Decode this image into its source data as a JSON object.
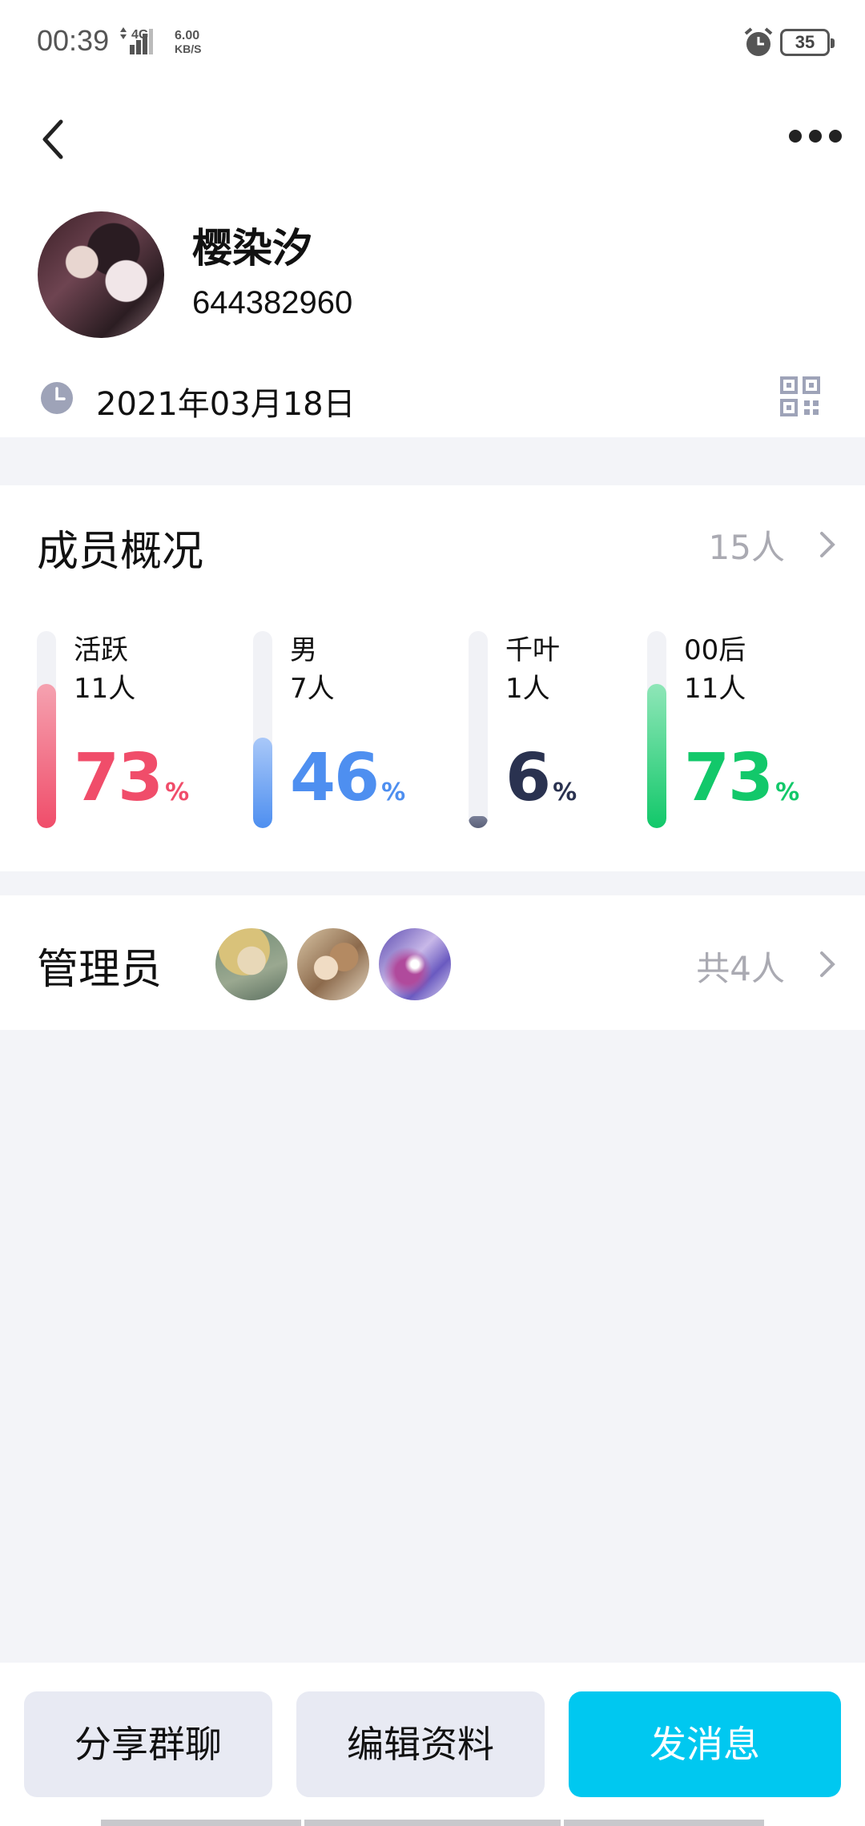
{
  "status_bar": {
    "time": "00:39",
    "network": "4G",
    "speed_value": "6.00",
    "speed_unit": "KB/S",
    "battery": "35"
  },
  "profile": {
    "name": "樱染汐",
    "id": "644382960",
    "date": "2021年03月18日"
  },
  "members": {
    "title": "成员概况",
    "total": "15人",
    "stats": [
      {
        "label": "活跃",
        "count": "11人",
        "percent": "73",
        "fraction": 0.73,
        "color": "#f04d6a",
        "fill_top": "#f5a2b0",
        "fill_bottom": "#f04d6a"
      },
      {
        "label": "男",
        "count": "7人",
        "percent": "46",
        "fraction": 0.46,
        "color": "#4e8ff0",
        "fill_top": "#a9c8f8",
        "fill_bottom": "#4e8ff0"
      },
      {
        "label": "千叶",
        "count": "1人",
        "percent": "6",
        "fraction": 0.06,
        "color": "#2a3250",
        "fill_top": "#7a8098",
        "fill_bottom": "#5a6078"
      },
      {
        "label": "00后",
        "count": "11人",
        "percent": "73",
        "fraction": 0.73,
        "color": "#12c86a",
        "fill_top": "#8fe6b8",
        "fill_bottom": "#12c86a"
      }
    ],
    "percent_sign": "%"
  },
  "admins": {
    "title": "管理员",
    "total": "共4人"
  },
  "actions": {
    "share": "分享群聊",
    "edit": "编辑资料",
    "message": "发消息"
  },
  "colors": {
    "primary": "#00c8f0",
    "background": "#f3f4f8"
  }
}
